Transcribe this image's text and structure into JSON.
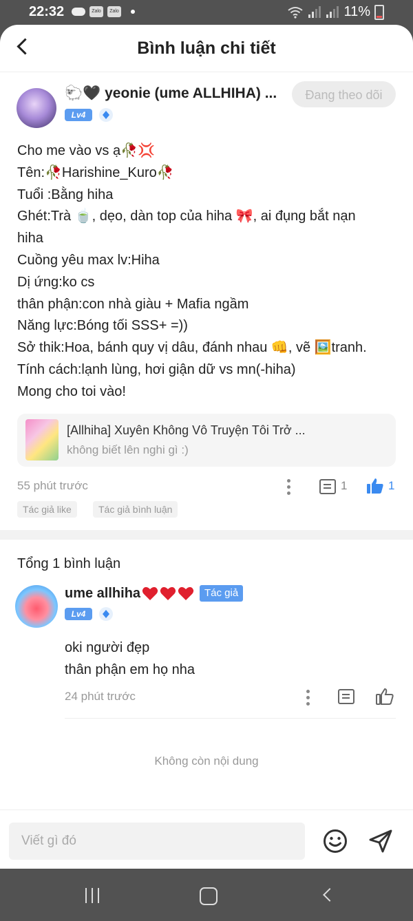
{
  "status_bar": {
    "time": "22:32",
    "notif_icons": [
      "Zalo",
      "Zalo"
    ],
    "battery": "11%"
  },
  "header": {
    "title": "Bình luận chi tiết"
  },
  "post": {
    "username": "🐑🖤 yeonie (ume ALLHIHA) ...",
    "level": "Lv4",
    "follow_label": "Đang theo dõi",
    "lines": [
      "Cho me vào vs ạ🥀💢",
      "Tên:🥀Harishine_Kuro🥀",
      "Tuổi :Bằng hiha",
      "Ghét:Trà 🍵, dẹo, dàn top của hiha 🎀, ai đụng bắt nạn",
      "hiha",
      "Cuồng yêu max lv:Hiha",
      "Dị ứng:ko cs",
      "thân phận:con nhà giàu + Mafia ngầm",
      "Năng lực:Bóng tối SSS+ =))",
      "Sở thik:Hoa, bánh quy vị dâu, đánh nhau 👊, vẽ 🖼️tranh.",
      "Tính cách:lạnh lùng, hơi giận dữ  vs mn(-hiha)",
      "Mong cho toi vào!"
    ],
    "story": {
      "title": "[Allhiha] Xuyên Không Vô Truyện Tôi Trở ...",
      "subtitle": "không biết lên nghi gì :)"
    },
    "time": "55 phút trước",
    "comment_count": "1",
    "like_count": "1",
    "tags": [
      "Tác giả like",
      "Tác giả bình luận"
    ]
  },
  "comments": {
    "total": "Tổng 1 bình luận",
    "items": [
      {
        "username": "ume allhiha",
        "hearts": "❤️❤️❤️",
        "badge": "Tác giả",
        "level": "Lv4",
        "lines": [
          "oki người đẹp",
          "thân phận em họ nha"
        ],
        "time": "24 phút trước"
      }
    ],
    "end_text": "Không còn nội dung"
  },
  "composer": {
    "placeholder": "Viết gì đó"
  },
  "colors": {
    "accent": "#3a8af0",
    "badge": "#5b9cf0",
    "muted": "#999999"
  }
}
